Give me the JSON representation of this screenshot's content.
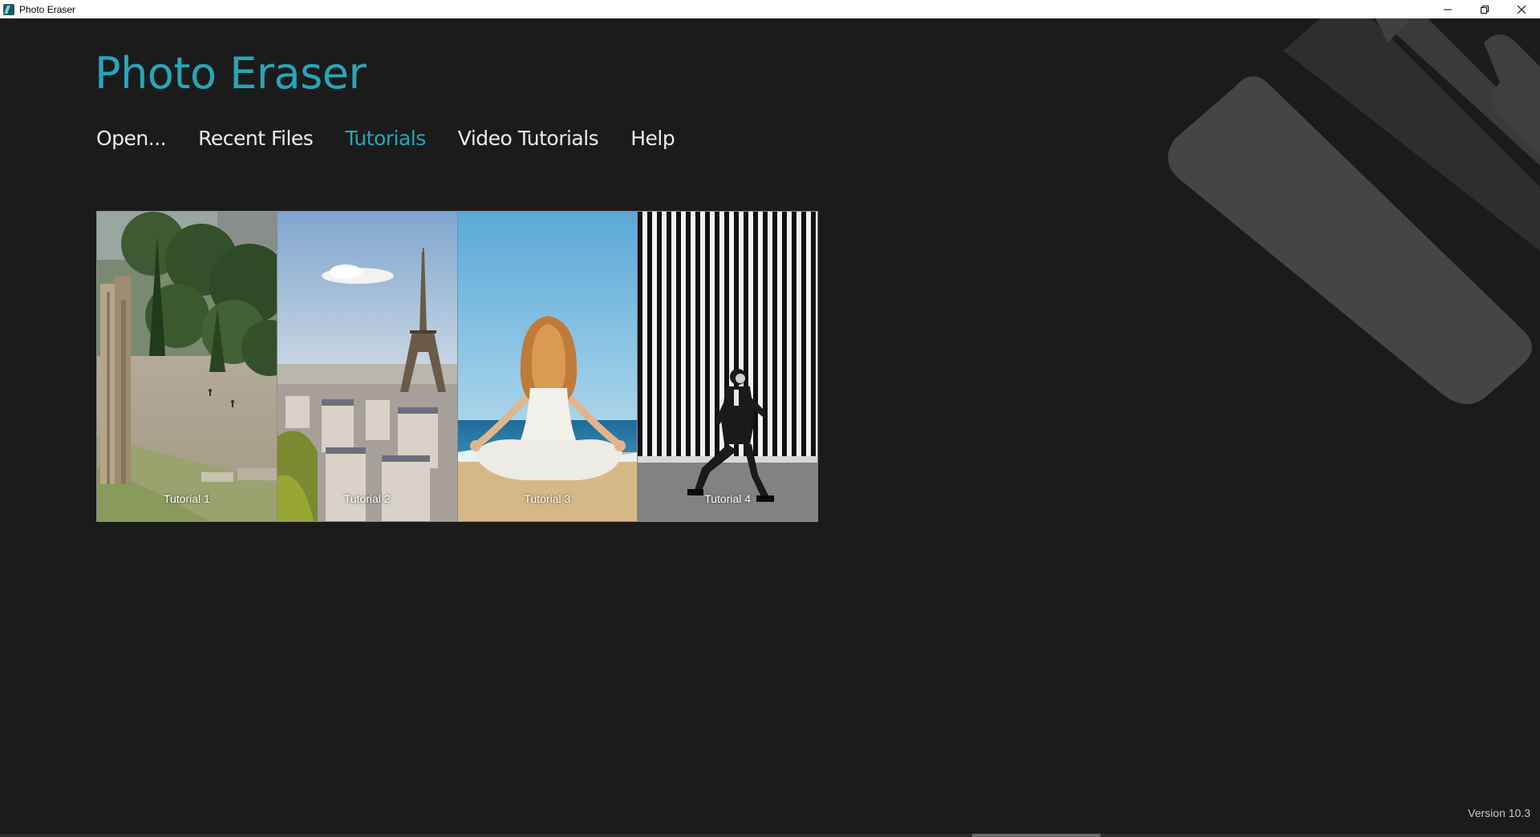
{
  "window": {
    "title": "Photo Eraser",
    "icon": "app-icon",
    "controls": [
      "minimize-icon",
      "restore-icon",
      "close-icon"
    ]
  },
  "app": {
    "title": "Photo Eraser"
  },
  "nav": {
    "items": [
      {
        "label": "Open...",
        "active": false
      },
      {
        "label": "Recent Files",
        "active": false
      },
      {
        "label": "Tutorials",
        "active": true
      },
      {
        "label": "Video Tutorials",
        "active": false
      },
      {
        "label": "Help",
        "active": false
      }
    ]
  },
  "tutorials": [
    {
      "label": "Tutorial 1"
    },
    {
      "label": "Tutorial 2"
    },
    {
      "label": "Tutorial 3"
    },
    {
      "label": "Tutorial 4"
    }
  ],
  "footer": {
    "version": "Version 10.3"
  },
  "colors": {
    "background": "#1b1b1b",
    "accent": "#26a6b8",
    "nav_text": "#ececec"
  }
}
